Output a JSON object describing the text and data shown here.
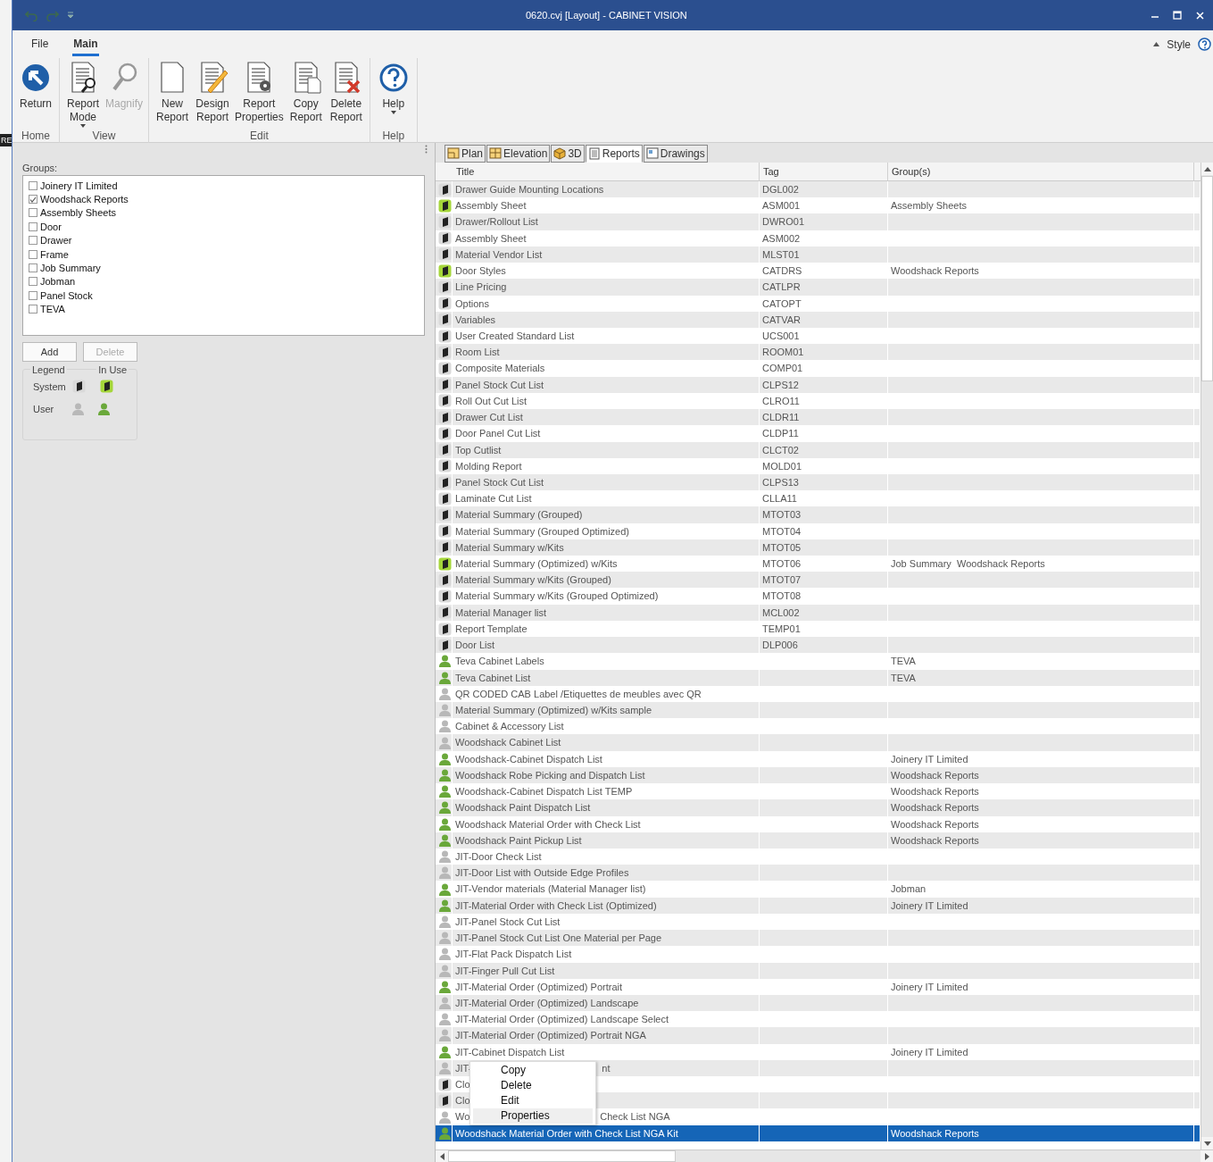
{
  "desktop_fragment": "RE",
  "window": {
    "title": "0620.cvj [Layout] - CABINET VISION"
  },
  "ribbon": {
    "tabs": [
      {
        "label": "File",
        "selected": false
      },
      {
        "label": "Main",
        "selected": true
      }
    ],
    "style_label": "Style",
    "groups": [
      {
        "label": "Home",
        "buttons": [
          {
            "lines": [
              "Return"
            ],
            "disabled": false,
            "dropdown": false
          }
        ]
      },
      {
        "label": "View",
        "buttons": [
          {
            "lines": [
              "Report",
              "Mode"
            ],
            "disabled": false,
            "dropdown": true
          },
          {
            "lines": [
              "Magnify"
            ],
            "disabled": true,
            "dropdown": false
          }
        ]
      },
      {
        "label": "Edit",
        "buttons": [
          {
            "lines": [
              "New",
              "Report"
            ],
            "disabled": false,
            "dropdown": false
          },
          {
            "lines": [
              "Design",
              "Report"
            ],
            "disabled": false,
            "dropdown": false
          },
          {
            "lines": [
              "Report",
              "Properties"
            ],
            "disabled": false,
            "dropdown": false
          },
          {
            "lines": [
              "Copy",
              "Report"
            ],
            "disabled": false,
            "dropdown": false
          },
          {
            "lines": [
              "Delete",
              "Report"
            ],
            "disabled": false,
            "dropdown": false
          }
        ]
      },
      {
        "label": "Help",
        "buttons": [
          {
            "lines": [
              "Help"
            ],
            "disabled": false,
            "dropdown": true
          }
        ]
      }
    ]
  },
  "groups_panel": {
    "label": "Groups:",
    "items": [
      {
        "label": "Joinery IT Limited",
        "checked": false
      },
      {
        "label": "Woodshack Reports",
        "checked": true
      },
      {
        "label": "Assembly Sheets",
        "checked": false
      },
      {
        "label": "Door",
        "checked": false
      },
      {
        "label": "Drawer",
        "checked": false
      },
      {
        "label": "Frame",
        "checked": false
      },
      {
        "label": "Job Summary",
        "checked": false
      },
      {
        "label": "Jobman",
        "checked": false
      },
      {
        "label": "Panel Stock",
        "checked": false
      },
      {
        "label": "TEVA",
        "checked": false
      }
    ],
    "buttons": [
      {
        "label": "Add",
        "disabled": false
      },
      {
        "label": "Delete",
        "disabled": true
      }
    ],
    "legend": {
      "title": "Legend",
      "column_label": "In Use",
      "rows": [
        {
          "label": "System",
          "kind": "system"
        },
        {
          "label": "User",
          "kind": "user"
        }
      ]
    }
  },
  "view_tabs": [
    {
      "label": "Plan",
      "selected": false
    },
    {
      "label": "Elevation",
      "selected": false
    },
    {
      "label": "3D",
      "selected": false
    },
    {
      "label": "Reports",
      "selected": true
    },
    {
      "label": "Drawings",
      "selected": false
    }
  ],
  "table": {
    "columns": [
      "Title",
      "Tag",
      "Group(s)"
    ],
    "rows": [
      {
        "kind": "system",
        "in_use": false,
        "title": "Drawer Guide Mounting Locations",
        "tag": "DGL002",
        "groups": "",
        "selected": false
      },
      {
        "kind": "system",
        "in_use": true,
        "title": "Assembly Sheet",
        "tag": "ASM001",
        "groups": "Assembly Sheets",
        "selected": false
      },
      {
        "kind": "system",
        "in_use": false,
        "title": "Drawer/Rollout List",
        "tag": "DWRO01",
        "groups": "",
        "selected": false
      },
      {
        "kind": "system",
        "in_use": false,
        "title": "Assembly Sheet",
        "tag": "ASM002",
        "groups": "",
        "selected": false
      },
      {
        "kind": "system",
        "in_use": false,
        "title": "Material Vendor List",
        "tag": "MLST01",
        "groups": "",
        "selected": false
      },
      {
        "kind": "system",
        "in_use": true,
        "title": "Door Styles",
        "tag": "CATDRS",
        "groups": "Woodshack Reports",
        "selected": false
      },
      {
        "kind": "system",
        "in_use": false,
        "title": "Line Pricing",
        "tag": "CATLPR",
        "groups": "",
        "selected": false
      },
      {
        "kind": "system",
        "in_use": false,
        "title": "Options",
        "tag": "CATOPT",
        "groups": "",
        "selected": false
      },
      {
        "kind": "system",
        "in_use": false,
        "title": "Variables",
        "tag": "CATVAR",
        "groups": "",
        "selected": false
      },
      {
        "kind": "system",
        "in_use": false,
        "title": "User Created Standard List",
        "tag": "UCS001",
        "groups": "",
        "selected": false
      },
      {
        "kind": "system",
        "in_use": false,
        "title": "Room List",
        "tag": "ROOM01",
        "groups": "",
        "selected": false
      },
      {
        "kind": "system",
        "in_use": false,
        "title": "Composite Materials",
        "tag": "COMP01",
        "groups": "",
        "selected": false
      },
      {
        "kind": "system",
        "in_use": false,
        "title": "Panel Stock Cut List",
        "tag": "CLPS12",
        "groups": "",
        "selected": false
      },
      {
        "kind": "system",
        "in_use": false,
        "title": "Roll Out Cut List",
        "tag": "CLRO11",
        "groups": "",
        "selected": false
      },
      {
        "kind": "system",
        "in_use": false,
        "title": "Drawer Cut List",
        "tag": "CLDR11",
        "groups": "",
        "selected": false
      },
      {
        "kind": "system",
        "in_use": false,
        "title": "Door Panel Cut List",
        "tag": "CLDP11",
        "groups": "",
        "selected": false
      },
      {
        "kind": "system",
        "in_use": false,
        "title": "Top Cutlist",
        "tag": "CLCT02",
        "groups": "",
        "selected": false
      },
      {
        "kind": "system",
        "in_use": false,
        "title": "Molding Report",
        "tag": "MOLD01",
        "groups": "",
        "selected": false
      },
      {
        "kind": "system",
        "in_use": false,
        "title": "Panel Stock Cut List",
        "tag": "CLPS13",
        "groups": "",
        "selected": false
      },
      {
        "kind": "system",
        "in_use": false,
        "title": "Laminate Cut List",
        "tag": "CLLA11",
        "groups": "",
        "selected": false
      },
      {
        "kind": "system",
        "in_use": false,
        "title": "Material Summary (Grouped)",
        "tag": "MTOT03",
        "groups": "",
        "selected": false
      },
      {
        "kind": "system",
        "in_use": false,
        "title": "Material Summary (Grouped Optimized)",
        "tag": "MTOT04",
        "groups": "",
        "selected": false
      },
      {
        "kind": "system",
        "in_use": false,
        "title": "Material Summary w/Kits",
        "tag": "MTOT05",
        "groups": "",
        "selected": false
      },
      {
        "kind": "system",
        "in_use": true,
        "title": "Material Summary (Optimized) w/Kits",
        "tag": "MTOT06",
        "groups": "Job Summary  Woodshack Reports",
        "selected": false
      },
      {
        "kind": "system",
        "in_use": false,
        "title": "Material Summary w/Kits (Grouped)",
        "tag": "MTOT07",
        "groups": "",
        "selected": false
      },
      {
        "kind": "system",
        "in_use": false,
        "title": "Material Summary w/Kits (Grouped Optimized)",
        "tag": "MTOT08",
        "groups": "",
        "selected": false
      },
      {
        "kind": "system",
        "in_use": false,
        "title": "Material Manager list",
        "tag": "MCL002",
        "groups": "",
        "selected": false
      },
      {
        "kind": "system",
        "in_use": false,
        "title": "Report Template",
        "tag": "TEMP01",
        "groups": "",
        "selected": false
      },
      {
        "kind": "system",
        "in_use": false,
        "title": "Door List",
        "tag": "DLP006",
        "groups": "",
        "selected": false
      },
      {
        "kind": "user",
        "in_use": true,
        "title": "Teva Cabinet Labels",
        "tag": "",
        "groups": "TEVA",
        "selected": false
      },
      {
        "kind": "user",
        "in_use": true,
        "title": "Teva Cabinet List",
        "tag": "",
        "groups": "TEVA",
        "selected": false
      },
      {
        "kind": "user",
        "in_use": false,
        "title": "QR CODED CAB Label /Etiquettes de meubles avec QR",
        "tag": "",
        "groups": "",
        "selected": false
      },
      {
        "kind": "user",
        "in_use": false,
        "title": "Material Summary (Optimized) w/Kits sample",
        "tag": "",
        "groups": "",
        "selected": false
      },
      {
        "kind": "user",
        "in_use": false,
        "title": "Cabinet & Accessory List",
        "tag": "",
        "groups": "",
        "selected": false
      },
      {
        "kind": "user",
        "in_use": false,
        "title": "Woodshack Cabinet List",
        "tag": "",
        "groups": "",
        "selected": false
      },
      {
        "kind": "user",
        "in_use": true,
        "title": "Woodshack-Cabinet Dispatch List",
        "tag": "",
        "groups": "Joinery IT Limited",
        "selected": false
      },
      {
        "kind": "user",
        "in_use": true,
        "title": "Woodshack Robe Picking and Dispatch List",
        "tag": "",
        "groups": "Woodshack Reports",
        "selected": false
      },
      {
        "kind": "user",
        "in_use": true,
        "title": "Woodshack-Cabinet Dispatch List TEMP",
        "tag": "",
        "groups": "Woodshack Reports",
        "selected": false
      },
      {
        "kind": "user",
        "in_use": true,
        "title": "Woodshack Paint Dispatch List",
        "tag": "",
        "groups": "Woodshack Reports",
        "selected": false
      },
      {
        "kind": "user",
        "in_use": true,
        "title": "Woodshack Material Order with Check List",
        "tag": "",
        "groups": "Woodshack Reports",
        "selected": false
      },
      {
        "kind": "user",
        "in_use": true,
        "title": "Woodshack Paint Pickup List",
        "tag": "",
        "groups": "Woodshack Reports",
        "selected": false
      },
      {
        "kind": "user",
        "in_use": false,
        "title": "JIT-Door Check List",
        "tag": "",
        "groups": "",
        "selected": false
      },
      {
        "kind": "user",
        "in_use": false,
        "title": "JIT-Door List with Outside Edge Profiles",
        "tag": "",
        "groups": "",
        "selected": false
      },
      {
        "kind": "user",
        "in_use": true,
        "title": "JIT-Vendor materials (Material Manager list)",
        "tag": "",
        "groups": "Jobman",
        "selected": false
      },
      {
        "kind": "user",
        "in_use": true,
        "title": "JIT-Material Order with Check List (Optimized)",
        "tag": "",
        "groups": "Joinery IT Limited",
        "selected": false
      },
      {
        "kind": "user",
        "in_use": false,
        "title": "JIT-Panel Stock Cut List",
        "tag": "",
        "groups": "",
        "selected": false
      },
      {
        "kind": "user",
        "in_use": false,
        "title": "JIT-Panel Stock Cut List One Material per Page",
        "tag": "",
        "groups": "",
        "selected": false
      },
      {
        "kind": "user",
        "in_use": false,
        "title": "JIT-Flat Pack Dispatch List",
        "tag": "",
        "groups": "",
        "selected": false
      },
      {
        "kind": "user",
        "in_use": false,
        "title": "JIT-Finger Pull Cut List",
        "tag": "",
        "groups": "",
        "selected": false
      },
      {
        "kind": "user",
        "in_use": true,
        "title": "JIT-Material Order (Optimized) Portrait",
        "tag": "",
        "groups": "Joinery IT Limited",
        "selected": false
      },
      {
        "kind": "user",
        "in_use": false,
        "title": "JIT-Material Order (Optimized) Landscape",
        "tag": "",
        "groups": "",
        "selected": false
      },
      {
        "kind": "user",
        "in_use": false,
        "title": "JIT-Material Order (Optimized) Landscape Select",
        "tag": "",
        "groups": "",
        "selected": false
      },
      {
        "kind": "user",
        "in_use": false,
        "title": "JIT-Material Order (Optimized) Portrait NGA",
        "tag": "",
        "groups": "",
        "selected": false
      },
      {
        "kind": "user",
        "in_use": true,
        "title": "JIT-Cabinet Dispatch List",
        "tag": "",
        "groups": "Joinery IT Limited",
        "selected": false
      },
      {
        "kind": "user",
        "in_use": false,
        "title": "JIT-",
        "title_tail": "nt",
        "tag": "",
        "groups": "",
        "selected": false
      },
      {
        "kind": "system",
        "in_use": false,
        "title": "Clo",
        "tag": "",
        "groups": "",
        "selected": false
      },
      {
        "kind": "system",
        "in_use": false,
        "title": "Clo",
        "tag": "",
        "groups": "",
        "selected": false
      },
      {
        "kind": "user",
        "in_use": false,
        "title": "Wo",
        "title_tail": "Check List NGA",
        "tag": "",
        "groups": "",
        "selected": false
      },
      {
        "kind": "user",
        "in_use": true,
        "title": "Woodshack Material Order with Check List NGA Kit",
        "tag": "",
        "groups": "Woodshack Reports",
        "selected": true
      }
    ]
  },
  "context_menu": {
    "items": [
      {
        "label": "Copy",
        "highlighted": false
      },
      {
        "label": "Delete",
        "highlighted": false
      },
      {
        "label": "Edit",
        "highlighted": false
      },
      {
        "label": "Properties",
        "highlighted": true
      }
    ]
  }
}
